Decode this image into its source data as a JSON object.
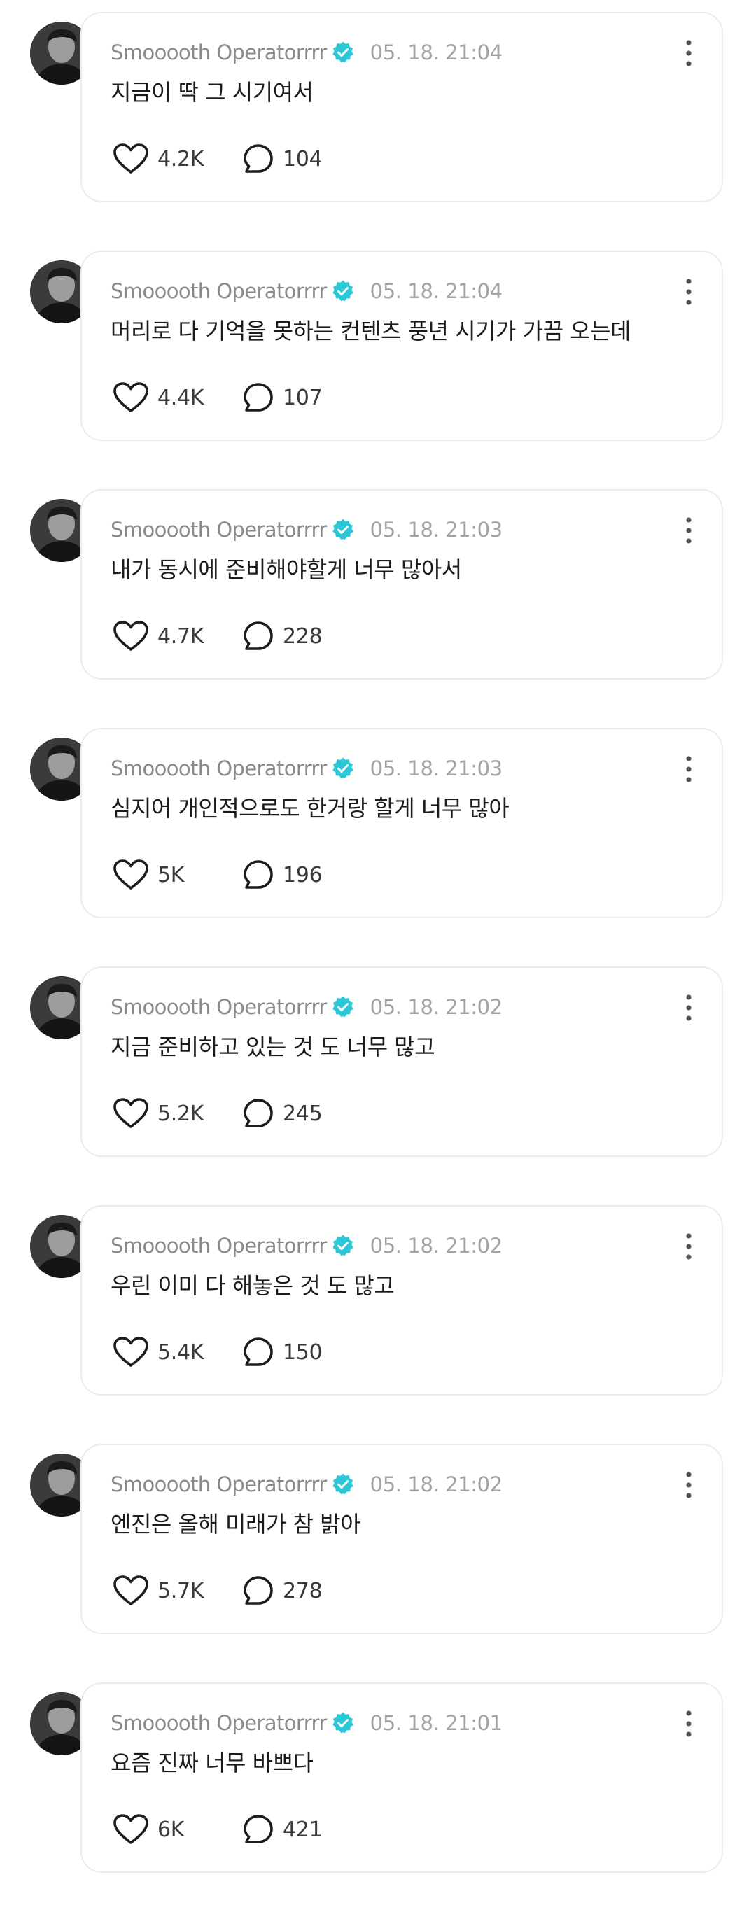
{
  "author": "Smooooth Operatorrrr",
  "colors": {
    "verified": "#2cc7d6",
    "card_border": "#ececec"
  },
  "icons": {
    "like": "heart-icon",
    "reply": "comment-bubble-icon",
    "more": "more-vertical-icon",
    "verified": "verified-badge-icon"
  },
  "posts": [
    {
      "time": "05. 18. 21:04",
      "text": "지금이 딱 그 시기여서",
      "likes": "4.2K",
      "replies": "104"
    },
    {
      "time": "05. 18. 21:04",
      "text": "머리로 다 기억을 못하는 컨텐츠 풍년 시기가 가끔 오는데",
      "likes": "4.4K",
      "replies": "107"
    },
    {
      "time": "05. 18. 21:03",
      "text": "내가 동시에 준비해야할게 너무 많아서",
      "likes": "4.7K",
      "replies": "228"
    },
    {
      "time": "05. 18. 21:03",
      "text": "심지어 개인적으로도 한거랑 할게 너무 많아",
      "likes": "5K",
      "replies": "196"
    },
    {
      "time": "05. 18. 21:02",
      "text": "지금 준비하고 있는 것 도 너무 많고",
      "likes": "5.2K",
      "replies": "245"
    },
    {
      "time": "05. 18. 21:02",
      "text": "우린 이미 다 해놓은 것 도 많고",
      "likes": "5.4K",
      "replies": "150"
    },
    {
      "time": "05. 18. 21:02",
      "text": "엔진은 올해 미래가 참 밝아",
      "likes": "5.7K",
      "replies": "278"
    },
    {
      "time": "05. 18. 21:01",
      "text": "요즘 진짜 너무 바쁘다",
      "likes": "6K",
      "replies": "421"
    }
  ]
}
